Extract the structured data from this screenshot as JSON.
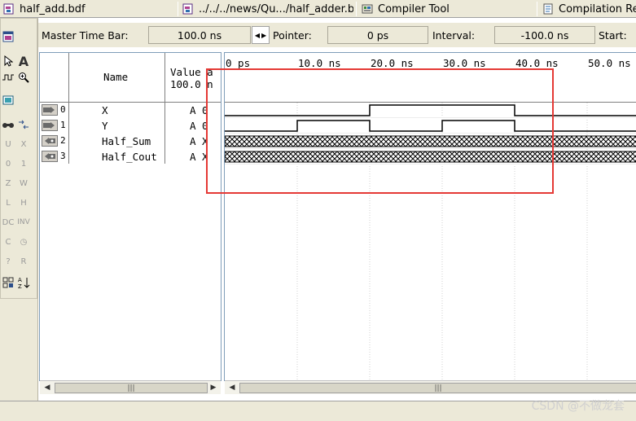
{
  "tabs": [
    {
      "label": "half_add.bdf",
      "icon": "bdf-file-icon"
    },
    {
      "label": "../../../news/Qu.../half_adder.bdf",
      "icon": "bdf-file-icon"
    },
    {
      "label": "Compiler Tool",
      "icon": "compiler-tool-icon"
    },
    {
      "label": "Compilation Re",
      "icon": "compilation-report-icon"
    }
  ],
  "master_time_bar": {
    "label": "Master Time Bar:",
    "value": "100.0 ns",
    "pointer_label": "Pointer:",
    "pointer_value": "0 ps",
    "interval_label": "Interval:",
    "interval_value": "-100.0 ns",
    "start_label": "Start:"
  },
  "signal_table": {
    "name_header": "Name",
    "value_header_line1": "Value a",
    "value_header_line2": "100.0 n",
    "rows": [
      {
        "index": "0",
        "name": "X",
        "value": "A 0",
        "type": "input"
      },
      {
        "index": "1",
        "name": "Y",
        "value": "A 0",
        "type": "input"
      },
      {
        "index": "2",
        "name": "Half_Sum",
        "value": "A X",
        "type": "output"
      },
      {
        "index": "3",
        "name": "Half_Cout",
        "value": "A X",
        "type": "output"
      }
    ]
  },
  "timeline": {
    "labels": [
      "0 ps",
      "10.0 ns",
      "20.0 ns",
      "30.0 ns",
      "40.0 ns",
      "50.0 ns"
    ],
    "ticks_ns": [
      0,
      10,
      20,
      30,
      40,
      50
    ],
    "range_ns": [
      0,
      57
    ]
  },
  "waveforms": {
    "X": {
      "kind": "digital",
      "transitions": [
        [
          0,
          0
        ],
        [
          20,
          1
        ],
        [
          40,
          0
        ]
      ]
    },
    "Y": {
      "kind": "digital",
      "transitions": [
        [
          0,
          0
        ],
        [
          10,
          1
        ],
        [
          20,
          0
        ],
        [
          30,
          1
        ],
        [
          40,
          0
        ]
      ]
    },
    "Half_Sum": {
      "kind": "unknown"
    },
    "Half_Cout": {
      "kind": "unknown"
    }
  },
  "highlight_color": "#e53935",
  "scroll_grip": "|||",
  "watermark": "CSDN @不做龙套"
}
